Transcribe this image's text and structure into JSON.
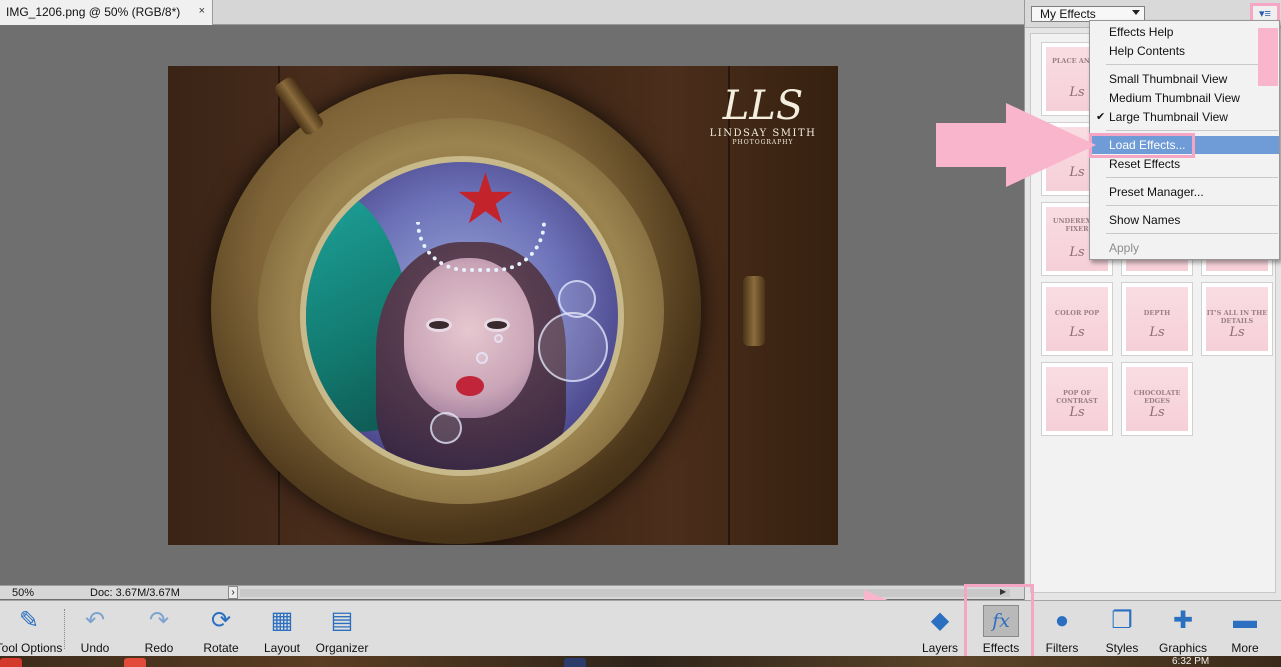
{
  "document": {
    "tab_title": "IMG_1206.png @ 50% (RGB/8*)",
    "close_glyph": "×",
    "watermark": {
      "mark": "LLS",
      "name": "LINDSAY SMITH",
      "subtitle": "PHOTOGRAPHY"
    }
  },
  "status": {
    "zoom": "50%",
    "doc_size": "Doc: 3.67M/3.67M",
    "arrow": "›"
  },
  "panel": {
    "dropdown_value": "My Effects",
    "menu_button_icon": "panel-menu-icon",
    "menu_button_glyph": "▾≡",
    "thumbnails": [
      {
        "label": "PLACE AND..."
      },
      {
        "label": ""
      },
      {
        "label": ""
      },
      {
        "label": "UNDEREXPO FIXER"
      },
      {
        "label": ""
      },
      {
        "label": ""
      },
      {
        "label": "COLOR POP"
      },
      {
        "label": "DEPTH"
      },
      {
        "label": "IT'S ALL IN THE DETAILS"
      },
      {
        "label": "POP OF CONTRAST"
      },
      {
        "label": "CHOCOLATE EDGES"
      }
    ],
    "thumb_signature": "Ls"
  },
  "menu": {
    "items": [
      {
        "label": "Effects Help"
      },
      {
        "label": "Help Contents"
      },
      {
        "label": "Small Thumbnail View"
      },
      {
        "label": "Medium Thumbnail View"
      },
      {
        "label": "Large Thumbnail View",
        "check": "✔"
      },
      {
        "label": "Load Effects..."
      },
      {
        "label": "Reset Effects"
      },
      {
        "label": "Preset Manager..."
      },
      {
        "label": "Show Names"
      },
      {
        "label": "Apply"
      }
    ]
  },
  "taskbar": {
    "left": [
      {
        "label": "Tool Options",
        "icon": "pencil-icon"
      },
      {
        "label": "Undo",
        "icon": "undo-icon"
      },
      {
        "label": "Redo",
        "icon": "redo-icon"
      },
      {
        "label": "Rotate",
        "icon": "rotate-icon"
      },
      {
        "label": "Layout",
        "icon": "layout-icon"
      },
      {
        "label": "Organizer",
        "icon": "organizer-icon"
      }
    ],
    "right": [
      {
        "label": "Layers",
        "icon": "layers-icon"
      },
      {
        "label": "Effects",
        "icon": "fx-icon",
        "glyph": "fx"
      },
      {
        "label": "Filters",
        "icon": "filters-icon"
      },
      {
        "label": "Styles",
        "icon": "styles-icon"
      },
      {
        "label": "Graphics",
        "icon": "graphics-icon"
      },
      {
        "label": "More",
        "icon": "more-icon"
      }
    ]
  },
  "os": {
    "clock": "6:32 PM"
  },
  "colors": {
    "accent_pink": "#f4a6c4",
    "menu_highlight": "#6f9bd7",
    "icon_blue": "#2b6fc0"
  }
}
